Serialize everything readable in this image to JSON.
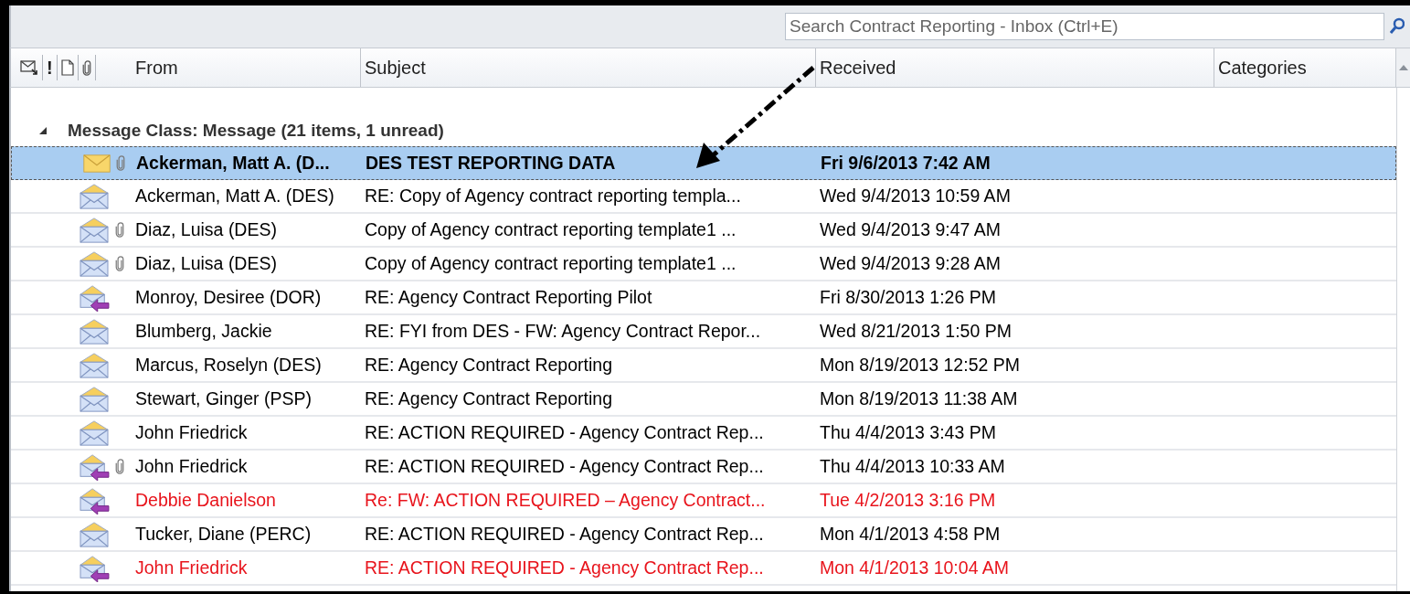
{
  "search": {
    "placeholder": "Search Contract Reporting - Inbox (Ctrl+E)"
  },
  "columns": {
    "importance": "!",
    "from": "From",
    "subject": "Subject",
    "received": "Received",
    "categories": "Categories"
  },
  "group": {
    "label": "Message Class: Message (21 items, 1 unread)",
    "expanded": true
  },
  "rows": [
    {
      "kind": "unread",
      "attachment": true,
      "selected": true,
      "color": "#000000",
      "from": "Ackerman, Matt A. (D...",
      "subject": "DES TEST REPORTING DATA",
      "received": "Fri 9/6/2013 7:42 AM"
    },
    {
      "kind": "read",
      "attachment": false,
      "selected": false,
      "color": "#000000",
      "from": "Ackerman, Matt A. (DES)",
      "subject": "RE: Copy of Agency contract reporting templa...",
      "received": "Wed 9/4/2013 10:59 AM"
    },
    {
      "kind": "read",
      "attachment": true,
      "selected": false,
      "color": "#000000",
      "from": "Diaz, Luisa (DES)",
      "subject": "Copy of Agency contract reporting template1 ...",
      "received": "Wed 9/4/2013 9:47 AM"
    },
    {
      "kind": "read",
      "attachment": true,
      "selected": false,
      "color": "#000000",
      "from": "Diaz, Luisa (DES)",
      "subject": "Copy of Agency contract reporting template1 ...",
      "received": "Wed 9/4/2013 9:28 AM"
    },
    {
      "kind": "replied",
      "attachment": false,
      "selected": false,
      "color": "#000000",
      "from": "Monroy, Desiree (DOR)",
      "subject": "RE: Agency Contract Reporting Pilot",
      "received": "Fri 8/30/2013 1:26 PM"
    },
    {
      "kind": "read",
      "attachment": false,
      "selected": false,
      "color": "#000000",
      "from": "Blumberg, Jackie",
      "subject": "RE: FYI from DES - FW: Agency Contract Repor...",
      "received": "Wed 8/21/2013 1:50 PM"
    },
    {
      "kind": "read",
      "attachment": false,
      "selected": false,
      "color": "#000000",
      "from": "Marcus, Roselyn (DES)",
      "subject": "RE: Agency Contract Reporting",
      "received": "Mon 8/19/2013 12:52 PM"
    },
    {
      "kind": "read",
      "attachment": false,
      "selected": false,
      "color": "#000000",
      "from": "Stewart, Ginger (PSP)",
      "subject": "RE: Agency Contract Reporting",
      "received": "Mon 8/19/2013 11:38 AM"
    },
    {
      "kind": "read",
      "attachment": false,
      "selected": false,
      "color": "#000000",
      "from": "John Friedrick",
      "subject": "RE: ACTION REQUIRED - Agency Contract Rep...",
      "received": "Thu 4/4/2013 3:43 PM"
    },
    {
      "kind": "replied",
      "attachment": true,
      "selected": false,
      "color": "#000000",
      "from": "John Friedrick",
      "subject": "RE: ACTION REQUIRED - Agency Contract Rep...",
      "received": "Thu 4/4/2013 10:33 AM"
    },
    {
      "kind": "replied",
      "attachment": false,
      "selected": false,
      "color": "#e8141c",
      "from": "Debbie Danielson",
      "subject": "Re: FW: ACTION REQUIRED – Agency Contract...",
      "received": "Tue 4/2/2013 3:16 PM"
    },
    {
      "kind": "read",
      "attachment": false,
      "selected": false,
      "color": "#000000",
      "from": "Tucker, Diane (PERC)",
      "subject": "RE: ACTION REQUIRED - Agency Contract Rep...",
      "received": "Mon 4/1/2013 4:58 PM"
    },
    {
      "kind": "replied",
      "attachment": false,
      "selected": false,
      "color": "#e8141c",
      "from": "John Friedrick",
      "subject": "RE: ACTION REQUIRED - Agency Contract Rep...",
      "received": "Mon 4/1/2013 10:04 AM"
    }
  ]
}
